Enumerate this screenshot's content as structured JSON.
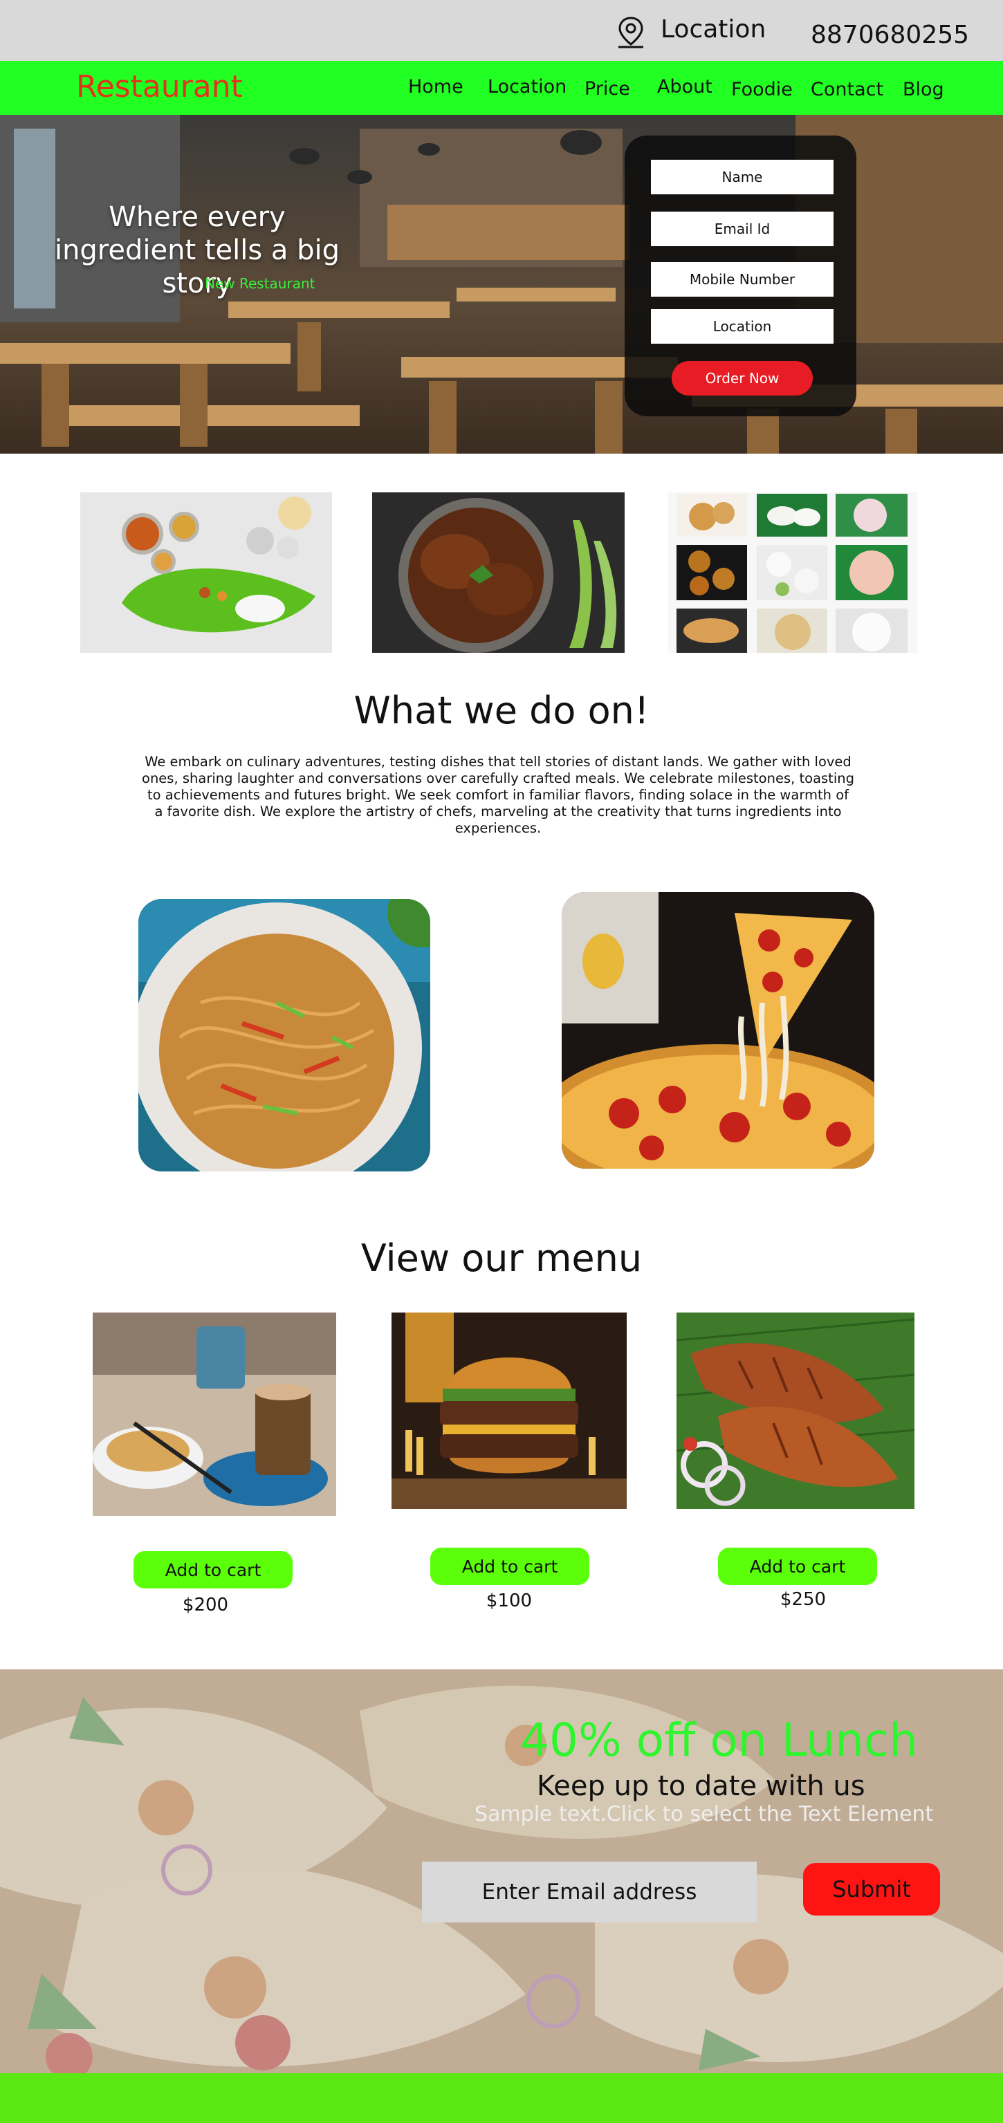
{
  "topbar": {
    "location_label": "Location",
    "phone": "8870680255",
    "location_icon": "map-pin-icon"
  },
  "nav": {
    "brand": "Restaurant",
    "brand_color": "#e0341b",
    "background": "#22ff22",
    "links": [
      "Home",
      "Location",
      "Price",
      "About",
      "Foodie",
      "Contact",
      "Blog"
    ]
  },
  "hero": {
    "headline_line1": "Where every",
    "headline_line2": "ingredient tells a big story",
    "subheading": "New Restaurant",
    "form": {
      "name_placeholder": "Name",
      "email_placeholder": "Email Id",
      "mobile_placeholder": "Mobile Number",
      "location_placeholder": "Location",
      "order_button": "Order Now"
    }
  },
  "about": {
    "title": "What we do on!",
    "text": "We embark on culinary adventures, testing dishes that tell stories of distant lands. We gather with loved ones, sharing laughter and conversations over carefully crafted meals. We celebrate milestones, toasting to achievements and futures bright. We seek comfort in familiar flavors, finding solace in the warmth of a favorite dish. We explore the artistry of chefs, marveling at the creativity that turns ingredients into experiences."
  },
  "menu": {
    "title": "View our menu",
    "items": [
      {
        "button": "Add to cart",
        "price": "$200"
      },
      {
        "button": "Add to cart",
        "price": "$100"
      },
      {
        "button": "Add to cart",
        "price": "$250"
      }
    ]
  },
  "promo": {
    "offer": "40% off on Lunch",
    "heading": "Keep up to date with us",
    "sample_text": "Sample text.Click to select the Text Element",
    "email_placeholder": "Enter Email address",
    "submit": "Submit"
  },
  "colors": {
    "accent_green": "#5cff0a",
    "order_red": "#e81c24",
    "submit_red": "#ff1414",
    "footer_green": "#5ce812"
  }
}
